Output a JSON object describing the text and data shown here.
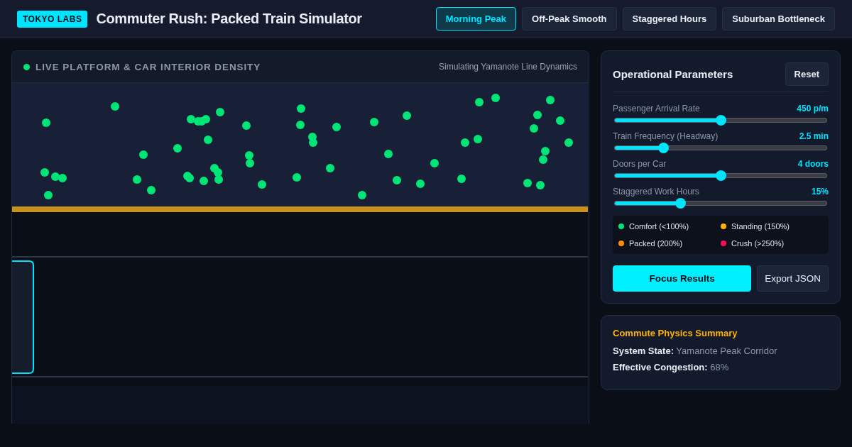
{
  "header": {
    "badge": "TOKYO LABS",
    "title": "Commuter Rush: Packed Train Simulator"
  },
  "scenarios": [
    {
      "label": "Morning Peak",
      "selected": true
    },
    {
      "label": "Off-Peak Smooth",
      "selected": false
    },
    {
      "label": "Staggered Hours",
      "selected": false
    },
    {
      "label": "Suburban Bottleneck",
      "selected": false
    }
  ],
  "visualization": {
    "title": "LIVE PLATFORM & CAR INTERIOR DENSITY",
    "subtitle": "Simulating Yamanote Line Dynamics",
    "live": true
  },
  "parameters": {
    "title": "Operational Parameters",
    "reset": "Reset",
    "sliders": [
      {
        "label": "Passenger Arrival Rate",
        "reading": "450 p/m",
        "level": 0.5
      },
      {
        "label": "Train Frequency (Headway)",
        "reading": "2.5 min",
        "level": 0.23
      },
      {
        "label": "Doors per Car",
        "reading": "4 doors",
        "level": 0.5
      },
      {
        "label": "Staggered Work Hours",
        "reading": "15%",
        "level": 0.31
      }
    ],
    "legend": [
      {
        "label": "Comfort (<100%)",
        "color": "#00e676"
      },
      {
        "label": "Standing (150%)",
        "color": "#ffb300"
      },
      {
        "label": "Packed (200%)",
        "color": "#ff8f00"
      },
      {
        "label": "Crush (>250%)",
        "color": "#ff0a54"
      }
    ],
    "buttons": [
      {
        "label": "Focus Results",
        "kind": "primary"
      },
      {
        "label": "Export JSON",
        "kind": "secondary"
      }
    ]
  },
  "summary": {
    "title": "Commute Physics Summary",
    "lines": [
      {
        "label": "System State:",
        "value": "Yamanote Peak Corridor"
      },
      {
        "label": "Effective Congestion:",
        "value": "68%"
      }
    ]
  }
}
